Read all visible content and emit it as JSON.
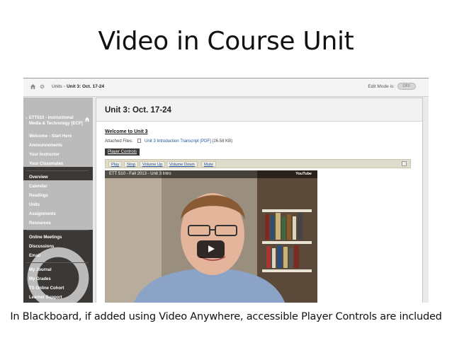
{
  "slide": {
    "title": "Video in Course Unit",
    "caption": "In Blackboard, if added using Video Anywhere, accessible Player Controls are included"
  },
  "topbar": {
    "breadcrumb_units": "Units",
    "breadcrumb_current": "Unit 3: Oct. 17-24",
    "edit_mode_label": "Edit Mode is:",
    "edit_mode_state": "OFF"
  },
  "sidebar": {
    "course_name": "ETT510 - Instructional Media & Technology [ECP]",
    "group1": [
      {
        "label": "Welcome - Start Here"
      },
      {
        "label": "Announcements"
      },
      {
        "label": "Your Instructor"
      },
      {
        "label": "Your Classmates"
      }
    ],
    "group2": [
      {
        "label": "Overview"
      },
      {
        "label": "Calendar"
      },
      {
        "label": "Readings"
      },
      {
        "label": "Units"
      },
      {
        "label": "Assignments"
      },
      {
        "label": "Resources"
      }
    ],
    "group3": [
      {
        "label": "Online Meetings"
      },
      {
        "label": "Discussions"
      },
      {
        "label": "Email"
      }
    ],
    "group4": [
      {
        "label": "My Journal"
      },
      {
        "label": "My Grades"
      },
      {
        "label": "TS Online Cohort"
      },
      {
        "label": "Learner Support"
      }
    ]
  },
  "main": {
    "unit_title": "Unit 3: Oct. 17-24",
    "welcome_heading": "Welcome to Unit 3",
    "attached_label": "Attached Files:",
    "attached_file": "Unit 3 Introduction Transcript [PDF]",
    "attached_size": "(26.58 KB)",
    "player_controls_label": "Player Controls",
    "controls": [
      "Play",
      "Stop",
      "Volume Up",
      "Volume Down",
      "Mute"
    ]
  },
  "video": {
    "title": "ETT 510 - Fall 2013 - Unit 3 Intro",
    "brand": "YouTube"
  },
  "colors": {
    "sidebar_bg": "#3b3836",
    "link": "#1f4f9a",
    "controls_bg": "#e0dccc"
  }
}
